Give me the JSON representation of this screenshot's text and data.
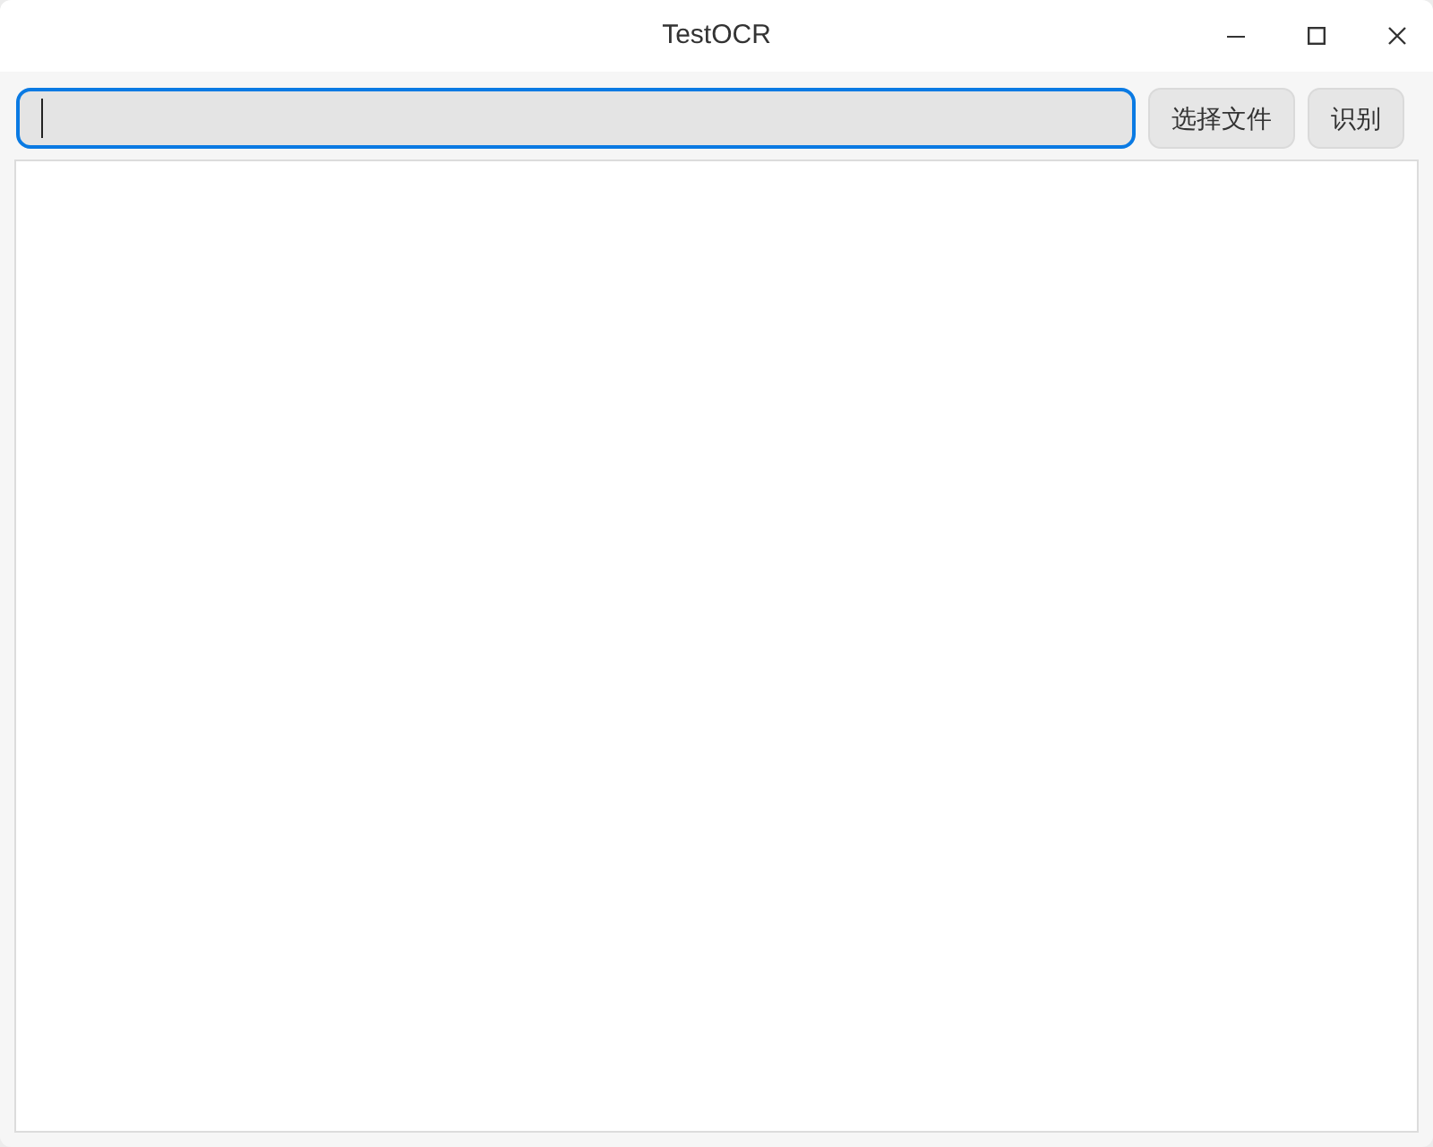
{
  "window": {
    "title": "TestOCR"
  },
  "path_field": {
    "focused": true
  },
  "buttons": [
    {
      "label": "选择文件"
    },
    {
      "label": "识别"
    }
  ]
}
